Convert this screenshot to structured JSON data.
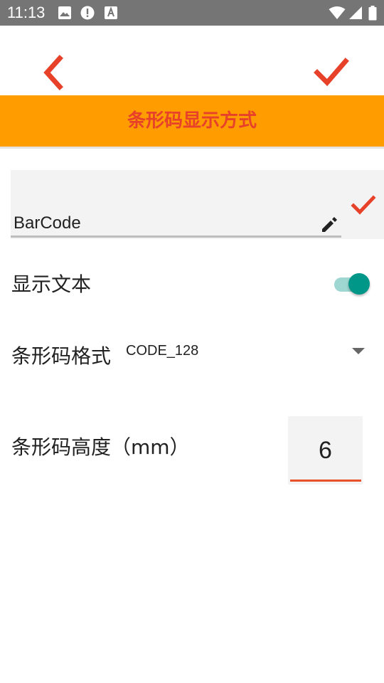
{
  "status_bar": {
    "time": "11:13",
    "icons": [
      "image-icon",
      "alert-icon",
      "font-icon",
      "wifi-icon",
      "signal-icon",
      "battery-icon"
    ]
  },
  "toolbar": {
    "back_icon": "chevron-left-icon",
    "confirm_icon": "check-icon"
  },
  "header": {
    "title": "条形码显示方式"
  },
  "name_field": {
    "value": "BarCode"
  },
  "show_text": {
    "label": "显示文本",
    "enabled": true
  },
  "barcode_format": {
    "label": "条形码格式",
    "value": "CODE_128"
  },
  "barcode_height": {
    "label": "条形码高度（mm）",
    "value": "6"
  },
  "colors": {
    "accent": "#e8412a",
    "title_bar": "#ff9c00",
    "switch": "#009688",
    "status_bar": "#757575"
  }
}
